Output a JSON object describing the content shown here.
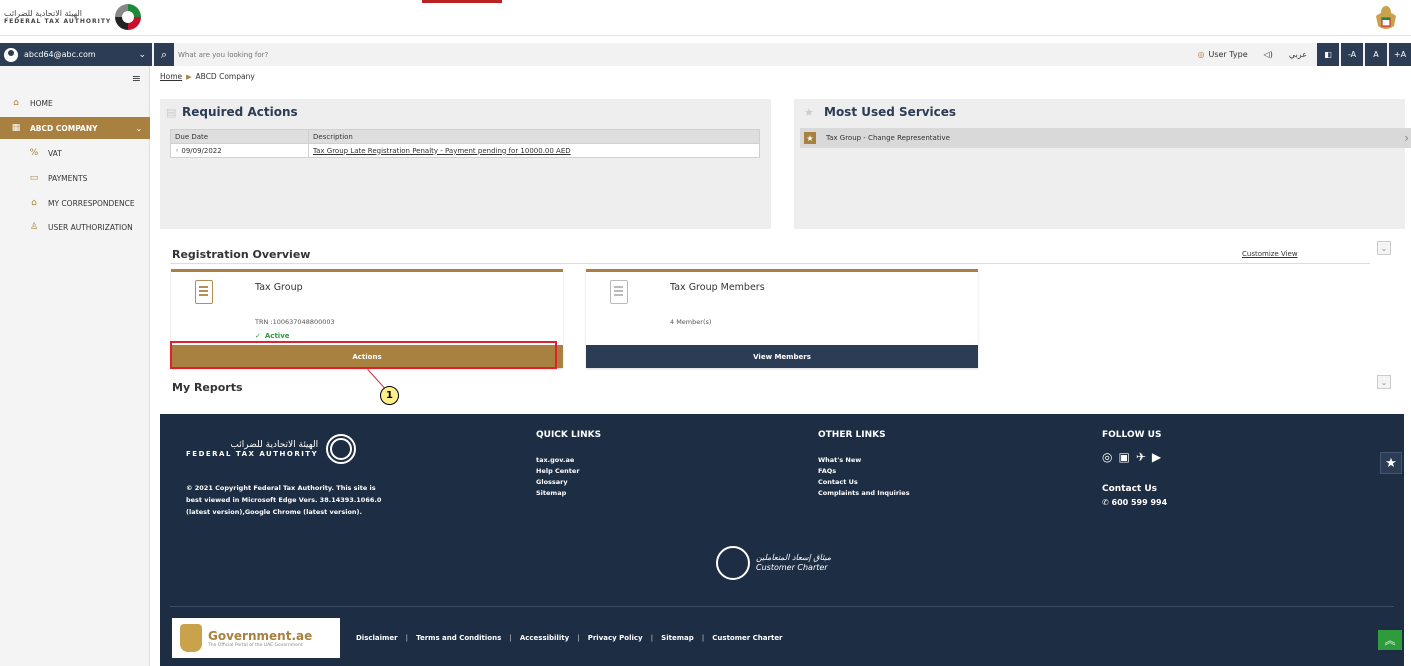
{
  "header": {
    "logo_ar": "الهيئة الاتحادية للضرائب",
    "logo_en": "FEDERAL TAX AUTHORITY"
  },
  "userbar": {
    "email": "abcd64@abc.com",
    "search_placeholder": "What are you looking for?",
    "user_type": "User Type",
    "arabic": "عربي",
    "font_minus": "-A",
    "font_normal": "A",
    "font_plus": "+A"
  },
  "sidebar": {
    "items": [
      {
        "label": "HOME"
      },
      {
        "label": "ABCD COMPANY"
      },
      {
        "label": "VAT"
      },
      {
        "label": "PAYMENTS"
      },
      {
        "label": "MY CORRESPONDENCE"
      },
      {
        "label": "USER AUTHORIZATION"
      }
    ]
  },
  "breadcrumb": {
    "home": "Home",
    "current": "ABCD Company"
  },
  "required_actions": {
    "title": "Required Actions",
    "columns": [
      "Due Date",
      "Description"
    ],
    "rows": [
      {
        "date": "09/09/2022",
        "description": "Tax Group Late Registration Penalty - Payment pending for 10000.00 AED"
      }
    ]
  },
  "most_used": {
    "title": "Most Used Services",
    "items": [
      "Tax Group - Change Representative"
    ]
  },
  "registration": {
    "title": "Registration Overview",
    "customize": "Customize View",
    "cards": [
      {
        "title": "Tax Group",
        "sub": "TRN :100637048800003",
        "status": "Active",
        "button": "Actions"
      },
      {
        "title": "Tax Group Members",
        "sub": "4 Member(s)",
        "button": "View Members"
      }
    ]
  },
  "reports": {
    "title": "My Reports"
  },
  "callout": {
    "number": "1"
  },
  "footer": {
    "logo_ar": "الهيئة الاتحادية للضرائب",
    "logo_en": "FEDERAL TAX AUTHORITY",
    "copyright": "© 2021 Copyright Federal Tax Authority. This site is best viewed in Microsoft Edge Vers. 38.14393.1066.0 (latest version),Google Chrome (latest version).",
    "quick_links": {
      "title": "QUICK LINKS",
      "items": [
        "tax.gov.ae",
        "Help Center",
        "Glossary",
        "Sitemap"
      ]
    },
    "other_links": {
      "title": "OTHER LINKS",
      "items": [
        "What's New",
        "FAQs",
        "Contact Us",
        "Complaints and Inquiries"
      ]
    },
    "follow": {
      "title": "FOLLOW US",
      "contact_title": "Contact Us",
      "phone": "600 599 994"
    },
    "charter_ar": "ميثاق إسعاد المتعاملين",
    "charter_en": "Customer Charter",
    "gov_main": "Government.ae",
    "gov_sub": "The Official Portal of the UAE Government",
    "bottom_links": [
      "Disclaimer",
      "Terms and Conditions",
      "Accessibility",
      "Privacy Policy",
      "Sitemap",
      "Customer Charter"
    ]
  }
}
